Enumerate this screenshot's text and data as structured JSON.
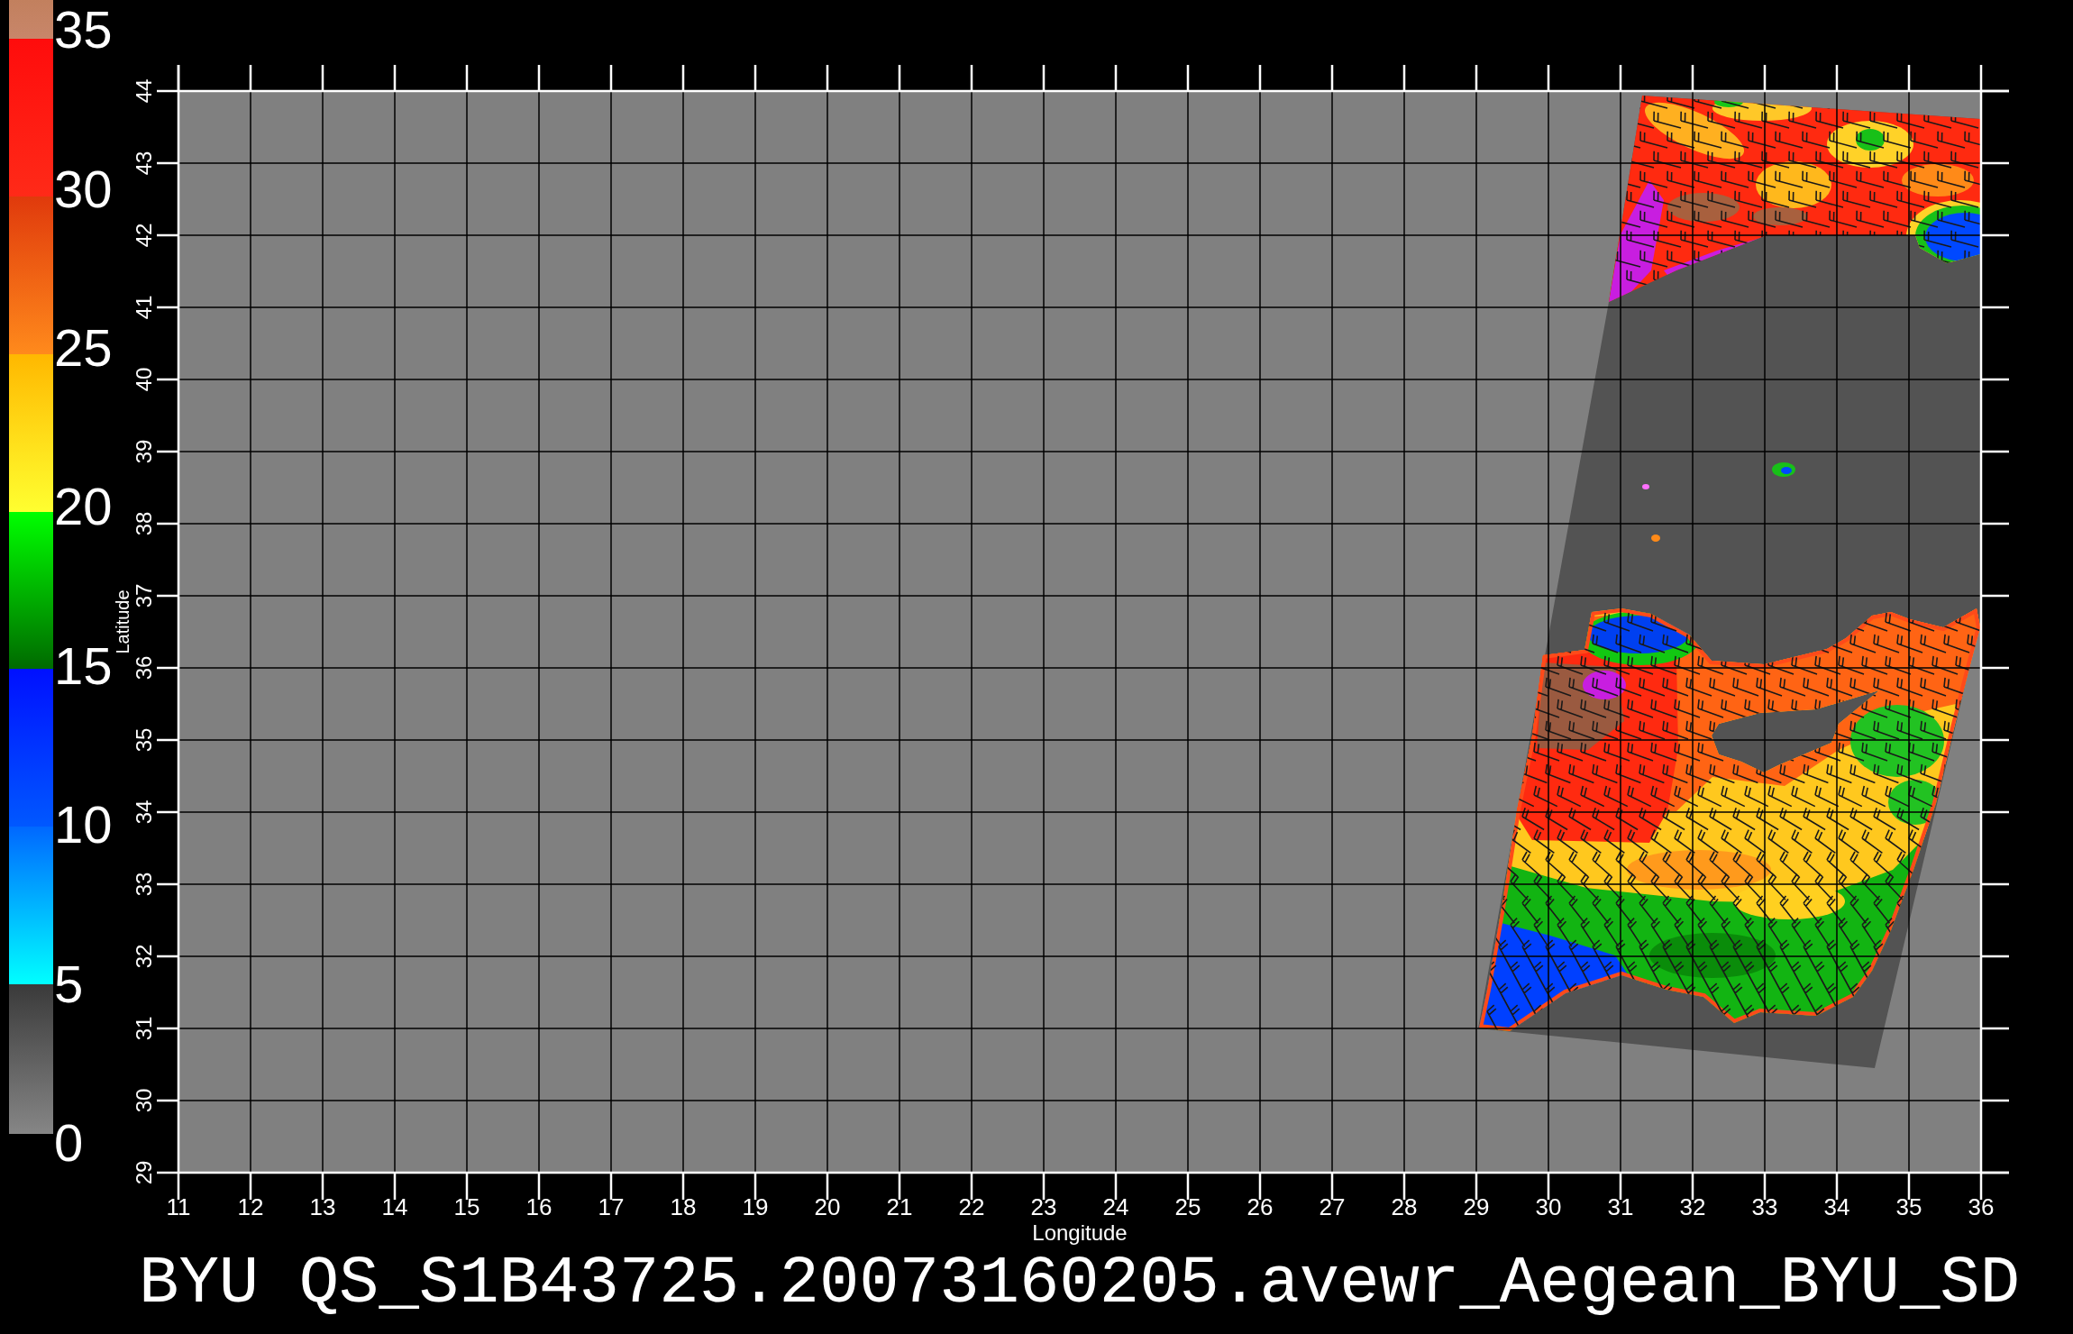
{
  "colorbar": {
    "labels": [
      "35",
      "30",
      "25",
      "20",
      "15",
      "10",
      "5",
      "0"
    ]
  },
  "map": {
    "ylabel": "Latitude",
    "lat_labels": [
      "44",
      "43",
      "42",
      "41",
      "40",
      "39",
      "38",
      "37",
      "36",
      "35",
      "34",
      "33",
      "32",
      "31",
      "30",
      "29"
    ],
    "xlabel": "Longitude",
    "lon_labels": [
      "11",
      "12",
      "13",
      "14",
      "15",
      "16",
      "17",
      "18",
      "19",
      "20",
      "21",
      "22",
      "23",
      "24",
      "25",
      "26",
      "27",
      "28",
      "29",
      "30",
      "31",
      "32",
      "33",
      "34",
      "35",
      "36"
    ]
  },
  "title": "BYU QS_S1B43725.20073160205.avewr_Aegean_BYU_SD"
}
